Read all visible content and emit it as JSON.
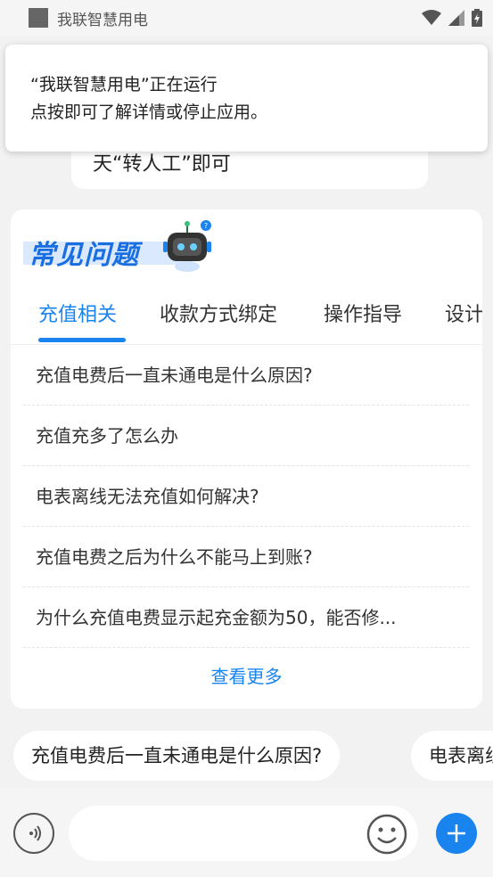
{
  "status_bar": {
    "app_name": "我联智慧用电"
  },
  "notification": {
    "line1": "“我联智慧用电”正在运行",
    "line2": "点按即可了解详情或停止应用。"
  },
  "chat_bubble": {
    "text": "天“转人工”即可"
  },
  "faq": {
    "title": "常见问题",
    "tabs": [
      {
        "label": "充值相关",
        "active": true
      },
      {
        "label": "收款方式绑定",
        "active": false
      },
      {
        "label": "操作指导",
        "active": false
      },
      {
        "label": "设计",
        "active": false
      }
    ],
    "items": [
      "充值电费后一直未通电是什么原因?",
      "充值充多了怎么办",
      "电表离线无法充值如何解决?",
      "充值电费之后为什么不能马上到账?",
      "为什么充值电费显示起充金额为50，能否修..."
    ],
    "more_label": "查看更多"
  },
  "chips": [
    "充值电费后一直未通电是什么原因?",
    "电表离线无法充值如何解决?"
  ],
  "input": {
    "placeholder": ""
  },
  "colors": {
    "accent": "#1a84ee",
    "background": "#f2f2f2"
  }
}
